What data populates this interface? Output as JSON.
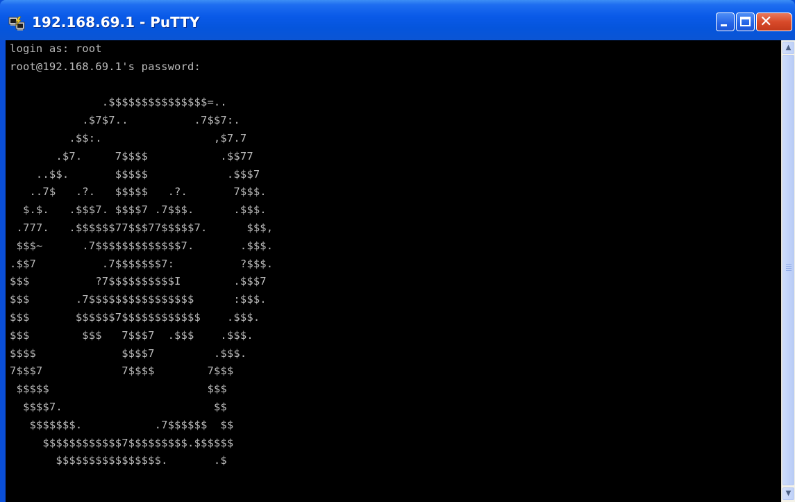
{
  "window": {
    "title": "192.168.69.1 - PuTTY",
    "icon": "putty-computer-icon",
    "buttons": {
      "minimize": "minimize-icon",
      "maximize": "maximize-icon",
      "close": "close-icon",
      "close_glyph": "✕"
    }
  },
  "terminal": {
    "lines": [
      "login as: root",
      "root@192.168.69.1's password:",
      "",
      "              .$$$$$$$$$$$$$$$=..",
      "           .$7$7..          .7$$7:.",
      "         .$$:.                 ,$7.7",
      "       .$7.     7$$$$           .$$77",
      "    ..$$.       $$$$$            .$$$7",
      "   ..7$   .?.   $$$$$   .?.       7$$$.",
      "  $.$.   .$$$7. $$$$7 .7$$$.      .$$$.",
      " .777.   .$$$$$$77$$$77$$$$$7.      $$$,",
      " $$$~      .7$$$$$$$$$$$$$7.       .$$$.",
      ".$$7          .7$$$$$$$7:          ?$$$.",
      "$$$          ?7$$$$$$$$$$I        .$$$7",
      "$$$       .7$$$$$$$$$$$$$$$$      :$$$.",
      "$$$       $$$$$$7$$$$$$$$$$$$    .$$$.",
      "$$$        $$$   7$$$7  .$$$    .$$$.",
      "$$$$             $$$$7         .$$$.",
      "7$$$7            7$$$$        7$$$",
      " $$$$$                        $$$",
      "  $$$$7.                       $$",
      "   $$$$$$$.           .7$$$$$$  $$",
      "     $$$$$$$$$$$$7$$$$$$$$$.$$$$$$",
      "       $$$$$$$$$$$$$$$$.       .$"
    ]
  },
  "scrollbar": {
    "up_glyph": "▲",
    "down_glyph": "▼"
  },
  "colors": {
    "titlebar": "#0a5ae8",
    "terminal_bg": "#000000",
    "terminal_fg": "#bbbbbb",
    "close_button": "#d84a2a"
  }
}
